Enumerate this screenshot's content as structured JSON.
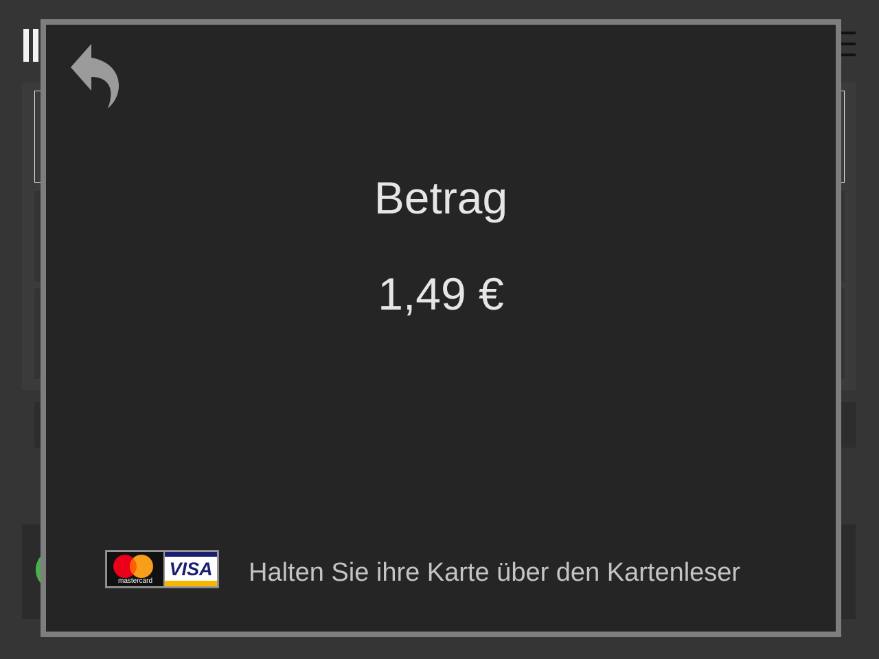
{
  "modal": {
    "title": "Betrag",
    "amount": "1,49 €",
    "instruction": "Halten Sie ihre Karte über den Kartenleser",
    "back_icon": "undo-arrow-icon",
    "card_logos": {
      "mastercard_label": "mastercard",
      "visa_label": "VISA"
    }
  },
  "background": {
    "logo_icon": "pause-bars-icon",
    "menu_icon": "hamburger-menu-icon"
  },
  "colors": {
    "page_bg": "#353535",
    "modal_bg": "#252525",
    "modal_border": "#7e7e7e",
    "text": "#e6e6e6",
    "instruction_text": "#c4c4c4",
    "mastercard_red": "#eb001b",
    "mastercard_orange": "#f79e1b",
    "visa_blue": "#1a1f71",
    "visa_gold": "#f7b600",
    "accent_green": "#4cb04a"
  }
}
